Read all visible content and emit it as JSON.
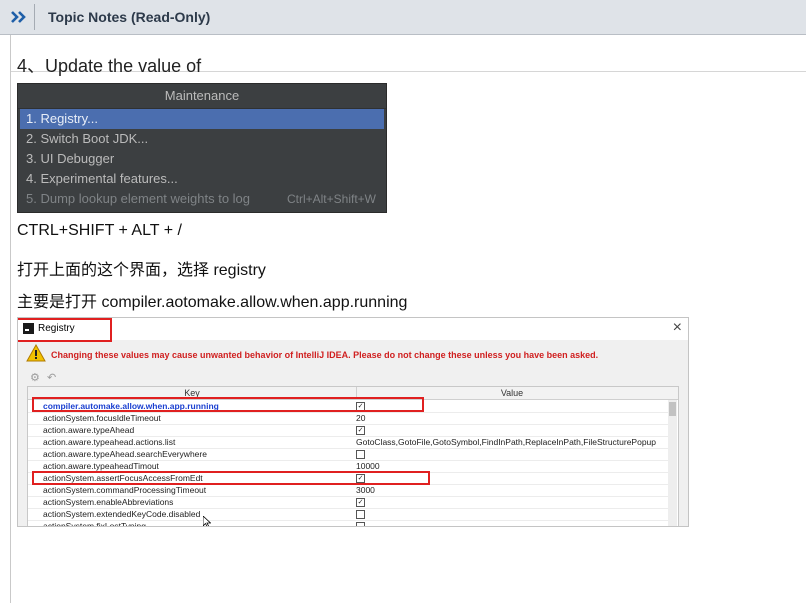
{
  "topbar": {
    "title": "Topic Notes (Read-Only)"
  },
  "heading": "4、Update the value of",
  "maintenance": {
    "title": "Maintenance",
    "items": [
      {
        "label": "1. Registry...",
        "shortcut": ""
      },
      {
        "label": "2. Switch Boot JDK...",
        "shortcut": ""
      },
      {
        "label": "3. UI Debugger",
        "shortcut": ""
      },
      {
        "label": "4. Experimental features...",
        "shortcut": ""
      },
      {
        "label": "5. Dump lookup element weights to log",
        "shortcut": "Ctrl+Alt+Shift+W"
      }
    ]
  },
  "paragraphs": [
    "CTRL+SHIFT + ALT + /",
    "打开上面的这个界面，选择 registry",
    "主要是打开 compiler.aotomake.allow.when.app.running"
  ],
  "registry": {
    "title": "Registry",
    "warning": "Changing these values may cause unwanted behavior of IntelliJ IDEA. Please do not change these unless you have been asked.",
    "columns": {
      "key": "Key",
      "value": "Value"
    },
    "rows": [
      {
        "key": "compiler.automake.allow.when.app.running",
        "value": "",
        "checkbox": true,
        "checked": true
      },
      {
        "key": "actionSystem.focusIdleTimeout",
        "value": "20",
        "checkbox": false,
        "checked": false
      },
      {
        "key": "action.aware.typeAhead",
        "value": "",
        "checkbox": true,
        "checked": true
      },
      {
        "key": "action.aware.typeahead.actions.list",
        "value": "GotoClass,GotoFile,GotoSymbol,FindInPath,ReplaceInPath,FileStructurePopup",
        "checkbox": false,
        "checked": false
      },
      {
        "key": "action.aware.typeAhead.searchEverywhere",
        "value": "",
        "checkbox": true,
        "checked": false
      },
      {
        "key": "action.aware.typeaheadTimout",
        "value": "10000",
        "checkbox": false,
        "checked": false
      },
      {
        "key": "actionSystem.assertFocusAccessFromEdt",
        "value": "",
        "checkbox": true,
        "checked": true
      },
      {
        "key": "actionSystem.commandProcessingTimeout",
        "value": "3000",
        "checkbox": false,
        "checked": false
      },
      {
        "key": "actionSystem.enableAbbreviations",
        "value": "",
        "checkbox": true,
        "checked": true
      },
      {
        "key": "actionSystem.extendedKeyCode.disabled",
        "value": "",
        "checkbox": true,
        "checked": false
      },
      {
        "key": "actionSystem.fixLostTyping",
        "value": "",
        "checkbox": true,
        "checked": false
      }
    ]
  },
  "colors": {
    "highlight_box": "#e02020",
    "selected_row": "#4b6eaf",
    "popup_bg": "#3c3f41"
  }
}
